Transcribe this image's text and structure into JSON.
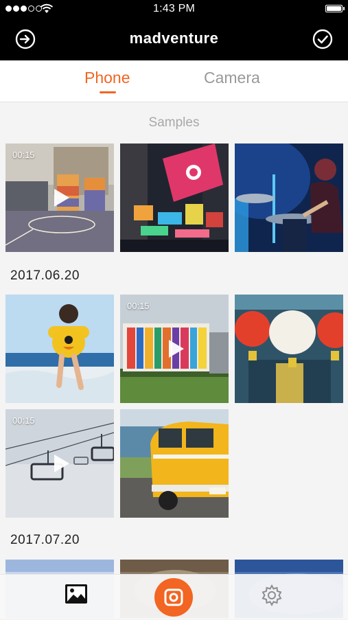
{
  "status_bar": {
    "time": "1:43 PM",
    "signal_bars": 3,
    "signal_total": 5,
    "icons": [
      "wifi-icon",
      "battery-icon"
    ]
  },
  "header": {
    "title": "madventure",
    "left_icon": "exit-icon",
    "right_icon": "check-circle-icon"
  },
  "tabs": [
    {
      "label": "Phone",
      "active": true
    },
    {
      "label": "Camera",
      "active": false
    }
  ],
  "accent_color": "#f26522",
  "sections": {
    "samples": {
      "title": "Samples",
      "items": [
        {
          "kind": "video",
          "duration": "00:15",
          "subject": "basketball court"
        },
        {
          "kind": "photo",
          "subject": "city billboards at night"
        },
        {
          "kind": "photo",
          "subject": "drummer on stage"
        }
      ]
    },
    "date_1": {
      "title": "2017.06.20",
      "items": [
        {
          "kind": "photo",
          "subject": "child at beach with floaties"
        },
        {
          "kind": "video",
          "duration": "00:15",
          "subject": "colorful USF building"
        },
        {
          "kind": "photo",
          "subject": "chinese lanterns"
        },
        {
          "kind": "video",
          "duration": "00:15",
          "subject": "ski lift in snow"
        },
        {
          "kind": "photo",
          "subject": "yellow van by the sea"
        }
      ]
    },
    "date_2": {
      "title": "2017.07.20",
      "items": [
        {
          "kind": "photo",
          "subject": "sky"
        },
        {
          "kind": "photo",
          "subject": "rocks"
        },
        {
          "kind": "photo",
          "subject": "blue texture"
        }
      ]
    }
  },
  "tab_bar": {
    "items": [
      {
        "icon": "gallery-icon"
      },
      {
        "icon": "camera-capture-icon"
      },
      {
        "icon": "gear-icon"
      }
    ]
  }
}
